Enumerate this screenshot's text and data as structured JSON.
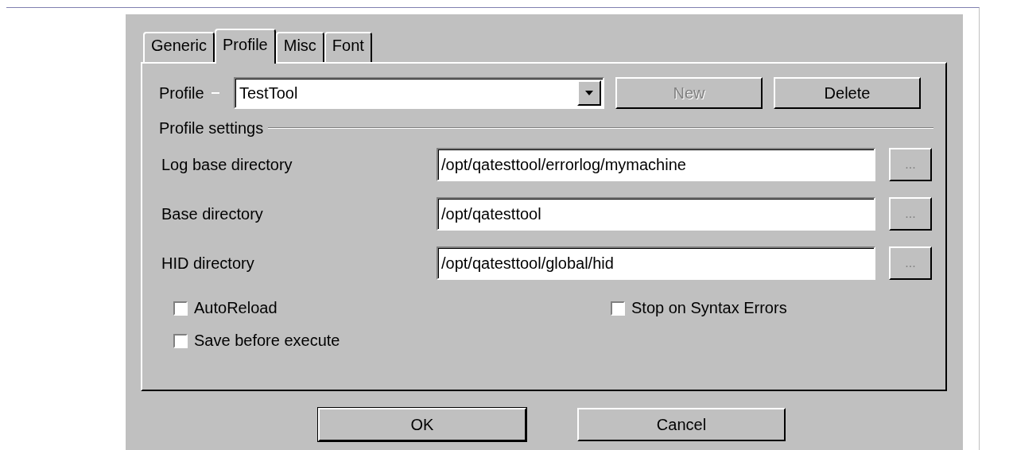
{
  "tabs": [
    {
      "label": "Generic",
      "selected": false
    },
    {
      "label": "Profile",
      "selected": true
    },
    {
      "label": "Misc",
      "selected": false
    },
    {
      "label": "Font",
      "selected": false
    }
  ],
  "profile": {
    "label": "Profile",
    "value": "TestTool"
  },
  "profile_buttons": [
    {
      "label": "New",
      "disabled": true
    },
    {
      "label": "Delete",
      "disabled": false
    }
  ],
  "group_title": "Profile settings",
  "directories": [
    {
      "label": "Log base directory",
      "value": "/opt/qatesttool/errorlog/mymachine",
      "browse": "..."
    },
    {
      "label": "Base directory",
      "value": "/opt/qatesttool",
      "browse": "..."
    },
    {
      "label": "HID directory",
      "value": "/opt/qatesttool/global/hid",
      "browse": "..."
    }
  ],
  "options": [
    {
      "label": "AutoReload",
      "checked": false
    },
    {
      "label": "Stop on Syntax Errors",
      "checked": false
    },
    {
      "label": "Save before execute",
      "checked": false
    }
  ],
  "buttons": [
    "OK",
    "Cancel"
  ]
}
